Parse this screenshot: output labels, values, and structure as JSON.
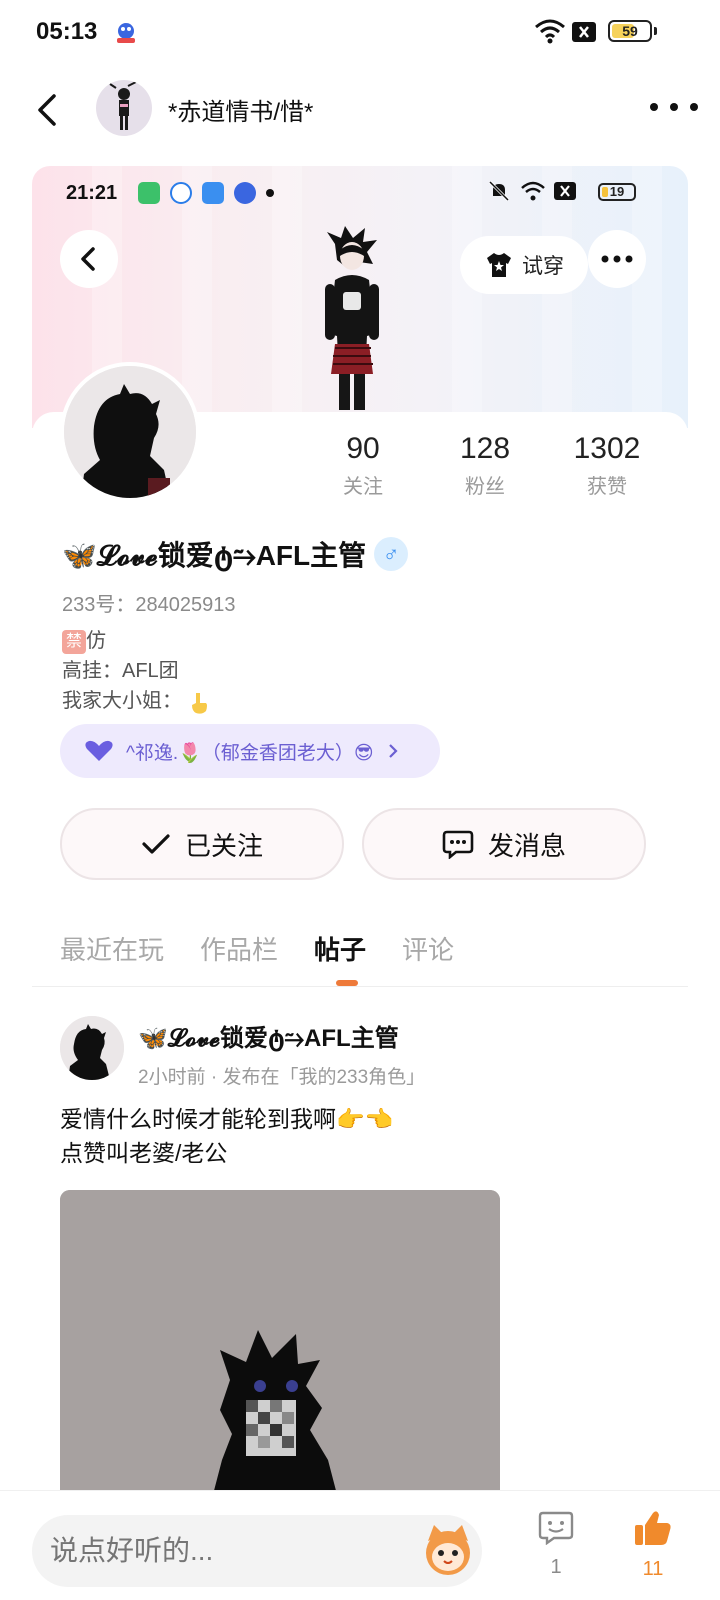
{
  "status_bar": {
    "time": "05:13",
    "battery": "59",
    "battery_level": 0.59,
    "icons": [
      "baidu-app-icon",
      "wifi-icon",
      "x-icon",
      "battery-icon"
    ]
  },
  "header": {
    "title": "*赤道情书/惜*"
  },
  "screenshot_card": {
    "inner_status": {
      "time": "21:21",
      "battery": "19",
      "battery_level": 0.19
    },
    "try_on_label": "试穿",
    "stats": [
      {
        "value": "90",
        "label": "关注"
      },
      {
        "value": "128",
        "label": "粉丝"
      },
      {
        "value": "1302",
        "label": "获赞"
      }
    ],
    "nickname": "🦋𝓛𝓸𝓿𝓮锁爱ტ⥲AFL主管",
    "gender": "♂",
    "uid": "233号：284025913",
    "bio": {
      "ban_tag": "禁",
      "line1_rest": "仿",
      "line2": "高挂：AFL团",
      "line3": "我家大小姐："
    },
    "guild_pill": "^祁逸.🌷（郁金香团老大）😎",
    "follow_button": "已关注",
    "message_button": "发消息",
    "tabs": [
      "最近在玩",
      "作品栏",
      "帖子",
      "评论"
    ],
    "active_tab": "帖子",
    "post": {
      "author": "🦋𝓛𝓸𝓿𝓮锁爱ტ⥲AFL主管",
      "meta": "2小时前 · 发布在「我的233角色」",
      "line1": "爱情什么时候才能轮到我啊👉👈",
      "line2": "点赞叫老婆/老公"
    }
  },
  "bottom_bar": {
    "input_placeholder": "说点好听的...",
    "comment_count": "1",
    "like_count": "11"
  },
  "colors": {
    "accent_orange": "#ee7a3a",
    "gender_blue": "#3a8ff0",
    "guild_purple": "#6b5fd2",
    "like_orange": "#f08a2c"
  }
}
